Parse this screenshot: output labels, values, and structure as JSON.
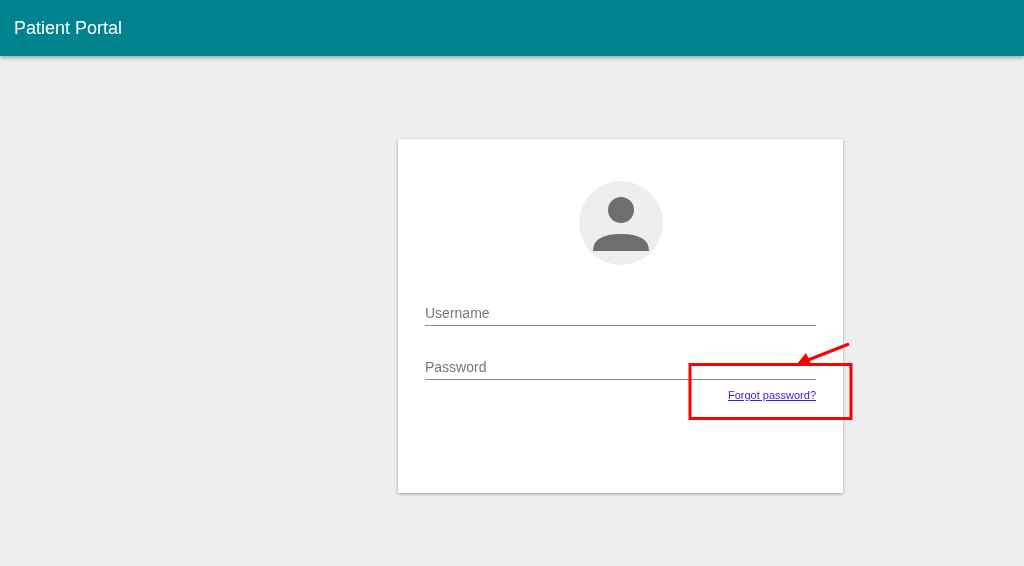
{
  "app_bar": {
    "title": "Patient Portal"
  },
  "login": {
    "username": {
      "placeholder": "Username"
    },
    "password": {
      "placeholder": "Password"
    },
    "forgot_link": "Forgot password?"
  }
}
